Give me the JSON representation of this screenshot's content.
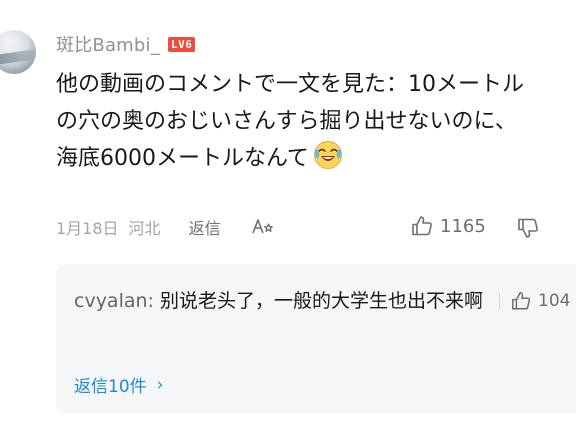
{
  "comment": {
    "username": "斑比Bambi_",
    "level_badge": "LV6",
    "text_lines": [
      "他の動画のコメントで一文を見た：10メートル",
      "の穴の奥のおじいさんすら掘り出せないのに、",
      "海底6000メートルなんて"
    ],
    "date": "1月18日",
    "region": "河北",
    "reply_label": "返信",
    "translate_icon": "A-star-translate-icon",
    "like_count": "1165"
  },
  "sub_reply": {
    "author": "cvyalan",
    "separator": ":",
    "text": " 别说老头了，一般的大学生也出不来啊",
    "like_count": "104"
  },
  "view_replies": {
    "label": "返信10件",
    "chevron": "›"
  },
  "colors": {
    "username": "#8f9296",
    "badge": "#f04b3b",
    "link": "#1f8ad6",
    "subbox_bg": "#f5f6f7"
  }
}
